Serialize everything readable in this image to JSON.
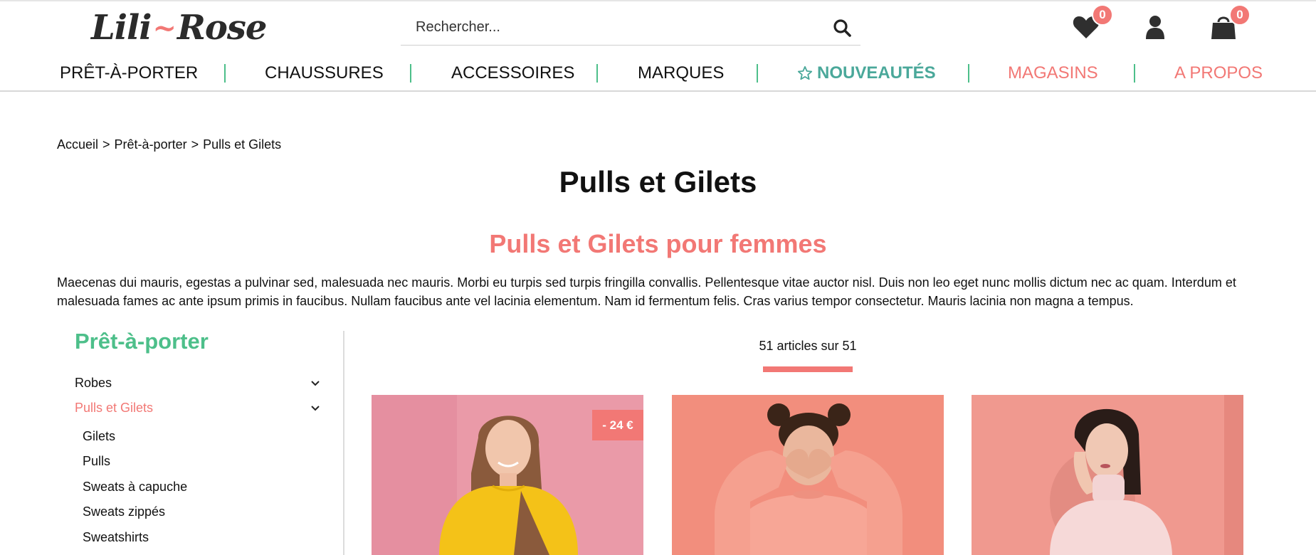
{
  "header": {
    "logo_left": "Lili",
    "logo_dash": "~",
    "logo_right": "Rose",
    "search_placeholder": "Rechercher...",
    "wishlist_count": "0",
    "cart_count": "0"
  },
  "nav": {
    "items": [
      {
        "label": "PRÊT-À-PORTER",
        "color": "#111111"
      },
      {
        "label": "CHAUSSURES",
        "color": "#111111"
      },
      {
        "label": "ACCESSOIRES",
        "color": "#111111"
      },
      {
        "label": "MARQUES",
        "color": "#111111"
      },
      {
        "label": "NOUVEAUTÉS",
        "color": "#4aa89a"
      },
      {
        "label": "MAGASINS",
        "color": "#f27875"
      },
      {
        "label": "A PROPOS",
        "color": "#f27875"
      }
    ]
  },
  "breadcrumb": {
    "home": "Accueil",
    "sep": ">",
    "parent": "Prêt-à-porter",
    "current": "Pulls et Gilets"
  },
  "page": {
    "title": "Pulls et Gilets",
    "subtitle": "Pulls et Gilets pour femmes",
    "description": "Maecenas dui mauris, egestas a pulvinar sed, malesuada nec mauris. Morbi eu turpis sed turpis fringilla convallis. Pellentesque vitae auctor nisl. Duis non leo eget nunc mollis dictum nec ac quam. Interdum et malesuada fames ac ante ipsum primis in faucibus. Nullam faucibus ante vel lacinia elementum. Nam id fermentum felis. Cras varius tempor consectetur. Mauris lacinia non magna a tempus."
  },
  "sidebar": {
    "title": "Prêt-à-porter",
    "categories": [
      {
        "label": "Robes",
        "active": false
      },
      {
        "label": "Pulls et Gilets",
        "active": true
      }
    ],
    "subcategories": [
      "Gilets",
      "Pulls",
      "Sweats à capuche",
      "Sweats zippés",
      "Sweatshirts"
    ]
  },
  "products": {
    "count_text": "51 articles sur 51",
    "items": [
      {
        "badge": "- 24 €",
        "image": "woman-yellow-sweater"
      },
      {
        "badge": "",
        "image": "woman-coral-sweatshirt-heart-hands"
      },
      {
        "badge": "",
        "image": "woman-pink-turtleneck"
      }
    ]
  },
  "colors": {
    "accent_pink": "#f27875",
    "accent_green": "#4dbf8a",
    "teal": "#4aa89a"
  }
}
